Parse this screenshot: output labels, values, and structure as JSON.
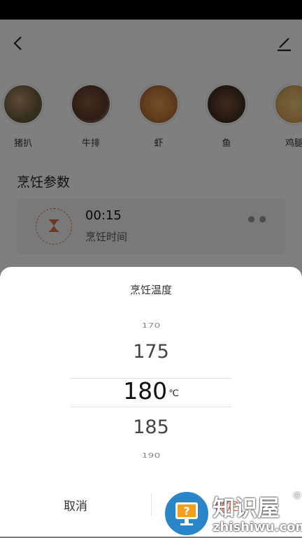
{
  "header": {
    "back_icon": "chevron-left-icon",
    "edit_icon": "pencil-icon"
  },
  "foods": [
    {
      "label": "猪扒",
      "color": "#6b5a3a"
    },
    {
      "label": "牛排",
      "color": "#7a4a34"
    },
    {
      "label": "虾",
      "color": "#c27a3a"
    },
    {
      "label": "鱼",
      "color": "#6a4630"
    },
    {
      "label": "鸡腿",
      "color": "#d9a860"
    }
  ],
  "section": {
    "title": "烹饪参数"
  },
  "param": {
    "time_value": "00:15",
    "time_label": "烹饪时间",
    "icon": "hourglass-icon",
    "accent": "#e06a3a"
  },
  "sheet": {
    "title": "烹饪温度",
    "options": [
      "170",
      "175",
      "180",
      "185",
      "190"
    ],
    "selected": "180",
    "unit": "℃",
    "cancel_label": "取消",
    "confirm_label": "确定"
  },
  "watermark": {
    "title": "知识屋",
    "subtitle": "zhishiwu.com",
    "reg": "®"
  }
}
